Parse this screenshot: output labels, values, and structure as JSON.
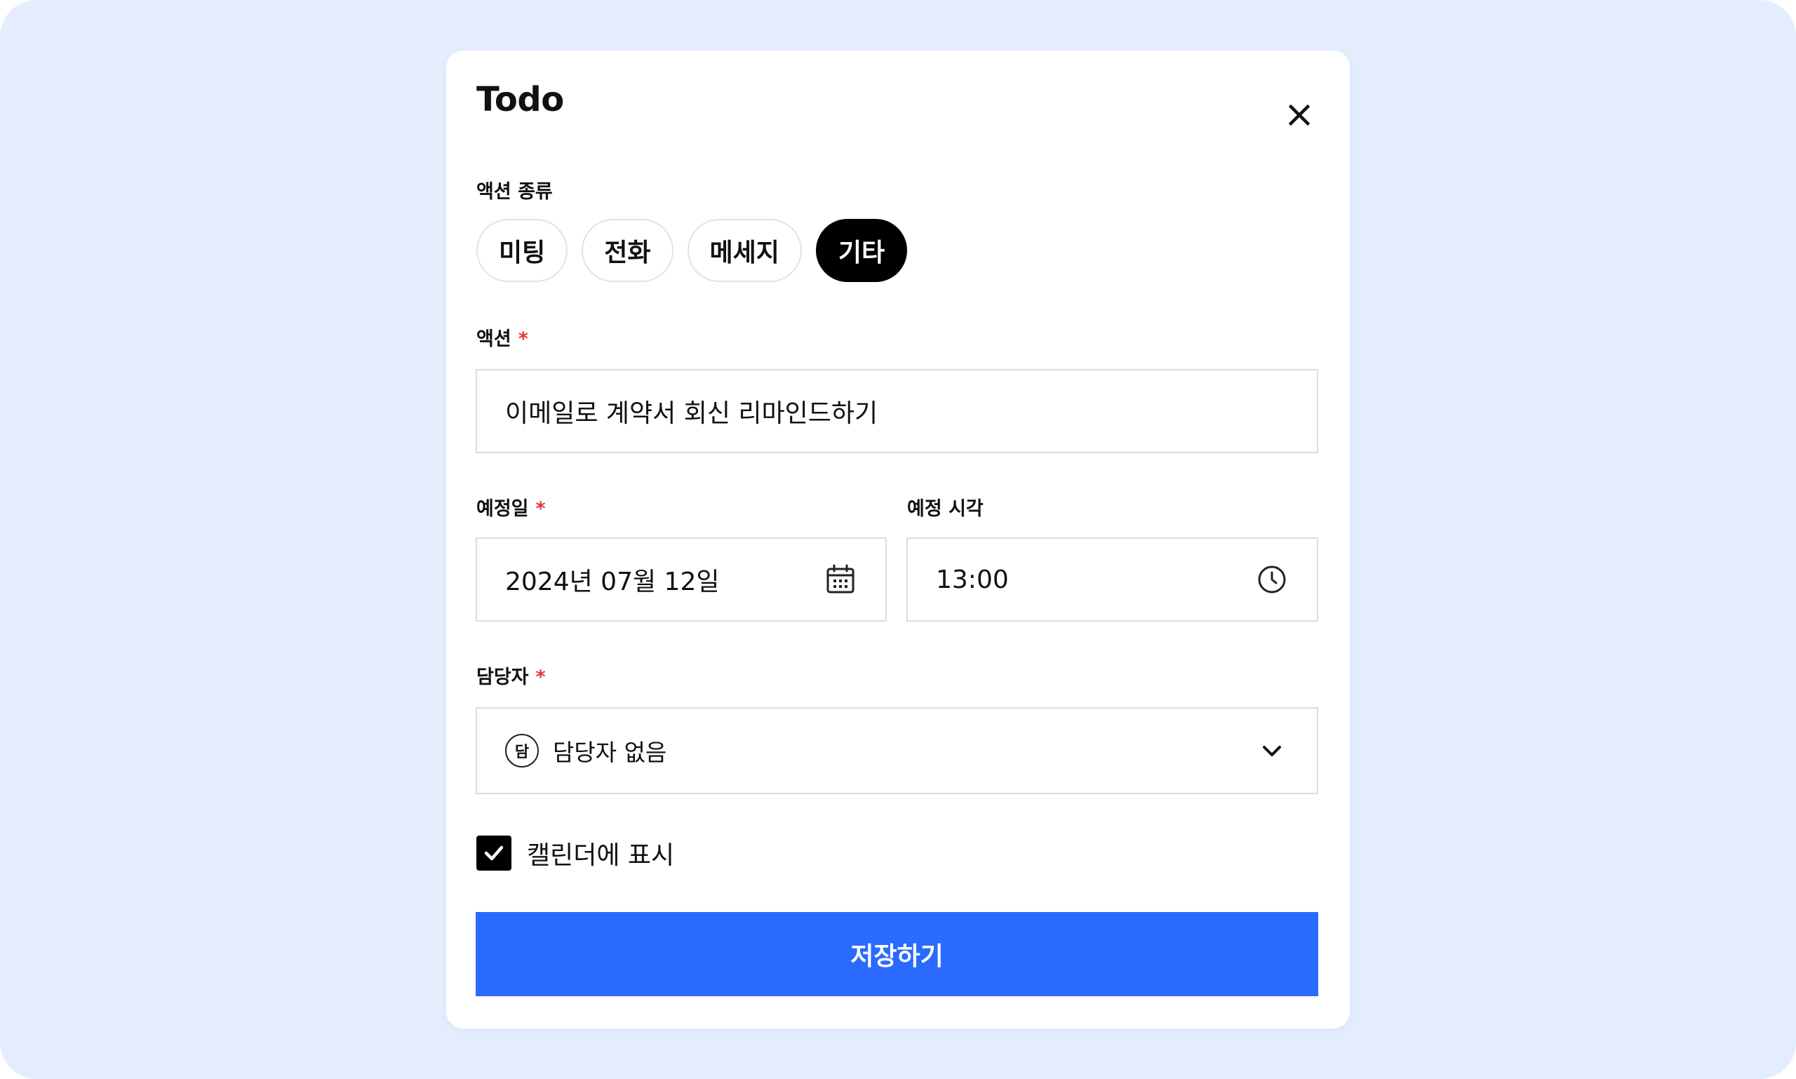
{
  "modal": {
    "title": "Todo"
  },
  "action_type": {
    "label": "액션 종류",
    "options": [
      "미팅",
      "전화",
      "메세지",
      "기타"
    ],
    "selected": "기타"
  },
  "action": {
    "label": "액션",
    "required_mark": "*",
    "value": "이메일로 계약서 회신 리마인드하기"
  },
  "due_date": {
    "label": "예정일",
    "required_mark": "*",
    "value": "2024년 07월 12일",
    "icon": "calendar-icon"
  },
  "due_time": {
    "label": "예정 시각",
    "value": "13:00",
    "icon": "clock-icon"
  },
  "assignee": {
    "label": "담당자",
    "required_mark": "*",
    "avatar_text": "담",
    "value": "담당자 없음",
    "icon": "chevron-down-icon"
  },
  "calendar_toggle": {
    "label": "캘린더에 표시",
    "checked": true
  },
  "save_button": {
    "label": "저장하기"
  },
  "colors": {
    "background": "#e3edfe",
    "primary": "#2a6afe",
    "required": "#e5333b",
    "chip_active": "#000000"
  }
}
